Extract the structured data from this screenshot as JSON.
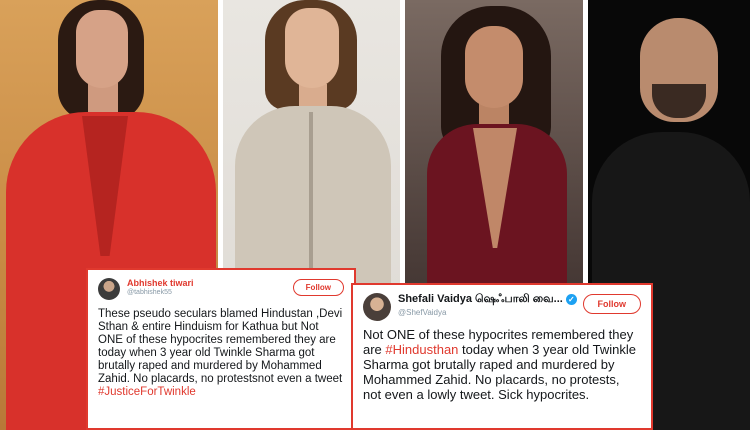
{
  "tweets": [
    {
      "name": "Abhishek tiwari",
      "handle": "@tabhishek55",
      "follow_label": "Follow",
      "text": "These pseudo seculars blamed Hindustan ,Devi Sthan & entire Hinduism for Kathua but Not ONE of these hypocrites remembered they are today when 3 year old Twinkle Sharma got brutally raped and murdered by Mohammed Zahid. No placards, no protestsnot even a tweet",
      "hashtag": "#JusticeForTwinkle"
    },
    {
      "name": "Shefali Vaidya ஷெஃபாலி வை...",
      "handle": "@ShefVaidya",
      "verified_mark": "✓",
      "follow_label": "Follow",
      "text_before": "Not ONE of these hypocrites remembered they are ",
      "hashtag": "#Hindusthan",
      "text_after": " today when 3 year old Twinkle Sharma got brutally raped and murdered by Mohammed Zahid. No placards, no protests, not even a lowly tweet. Sick hypocrites."
    }
  ],
  "colors": {
    "accent_red": "#e0392e",
    "verified_blue": "#1da1f2"
  }
}
